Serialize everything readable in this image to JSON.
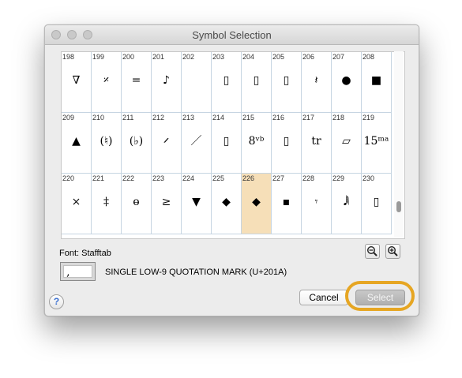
{
  "window": {
    "title": "Symbol Selection"
  },
  "grid": {
    "rows": [
      [
        {
          "num": "198",
          "glyph": "∇"
        },
        {
          "num": "199",
          "glyph": "𝄎"
        },
        {
          "num": "200",
          "glyph": "="
        },
        {
          "num": "201",
          "glyph": "♪"
        },
        {
          "num": "202",
          "glyph": ""
        },
        {
          "num": "203",
          "glyph": "▯"
        },
        {
          "num": "204",
          "glyph": "▯"
        },
        {
          "num": "205",
          "glyph": "▯"
        },
        {
          "num": "206",
          "glyph": "𝄽"
        },
        {
          "num": "207",
          "glyph": "●"
        },
        {
          "num": "208",
          "glyph": "■"
        }
      ],
      [
        {
          "num": "209",
          "glyph": "▲"
        },
        {
          "num": "210",
          "glyph": "(♮)"
        },
        {
          "num": "211",
          "glyph": "(♭)"
        },
        {
          "num": "212",
          "glyph": "𝄍"
        },
        {
          "num": "213",
          "glyph": "／"
        },
        {
          "num": "214",
          "glyph": "▯"
        },
        {
          "num": "215",
          "glyph": "8ᵛᵇ"
        },
        {
          "num": "216",
          "glyph": "▯"
        },
        {
          "num": "217",
          "glyph": "tr"
        },
        {
          "num": "218",
          "glyph": "▱"
        },
        {
          "num": "219",
          "glyph": "15ᵐᵃ"
        }
      ],
      [
        {
          "num": "220",
          "glyph": "×"
        },
        {
          "num": "221",
          "glyph": "‡"
        },
        {
          "num": "222",
          "glyph": "ɵ"
        },
        {
          "num": "223",
          "glyph": "≥"
        },
        {
          "num": "224",
          "glyph": "▼"
        },
        {
          "num": "225",
          "glyph": "◆"
        },
        {
          "num": "226",
          "glyph": "◆"
        },
        {
          "num": "227",
          "glyph": "▪"
        },
        {
          "num": "228",
          "glyph": "𝄾"
        },
        {
          "num": "229",
          "glyph": "𝅘𝅥𝅲"
        },
        {
          "num": "230",
          "glyph": "▯"
        }
      ]
    ],
    "selected": "226"
  },
  "font_label": "Font:  Stafftab",
  "preview": {
    "glyph": "‚"
  },
  "character_name": "SINGLE LOW-9 QUOTATION MARK (U+201A)",
  "buttons": {
    "cancel": "Cancel",
    "select": "Select",
    "help": "?"
  },
  "icons": {
    "zoom_out": "zoom-out-icon",
    "zoom_in": "zoom-in-icon"
  },
  "colors": {
    "selected_cell": "#f6dfb8",
    "highlight_ring": "#e6a623"
  }
}
